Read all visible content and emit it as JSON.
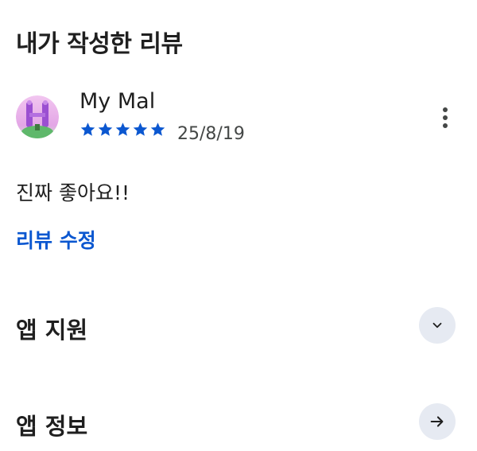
{
  "reviews_section": {
    "title": "내가 작성한 리뷰"
  },
  "review": {
    "reviewer_name": "My Mal",
    "rating": 5,
    "rating_max": 5,
    "date": "25/8/19",
    "body": "진짜 좋아요!!",
    "edit_label": "리뷰 수정",
    "star_color": "#0b57d0",
    "more_icon": "more-vert-icon"
  },
  "rows": [
    {
      "title": "앱 지원",
      "icon": "chevron-down-icon"
    },
    {
      "title": "앱 정보",
      "icon": "arrow-right-icon"
    }
  ],
  "colors": {
    "accent": "#0b57d0",
    "row_button_bg": "#e6eaf2"
  }
}
